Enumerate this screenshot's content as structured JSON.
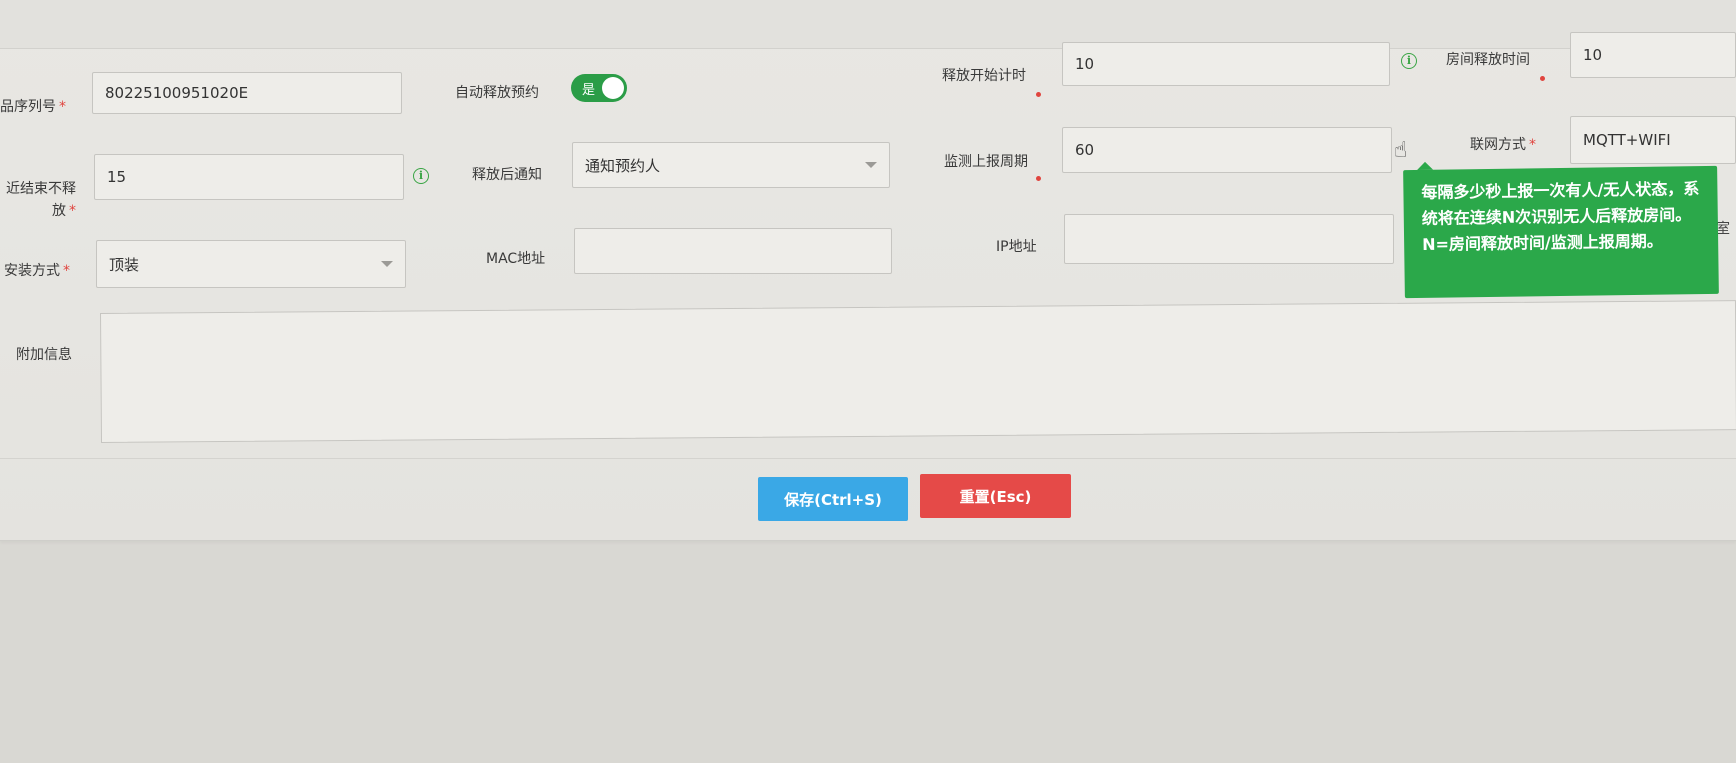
{
  "form": {
    "serial": {
      "label": "品序列号",
      "value": "80225100951020E"
    },
    "auto_release": {
      "label": "自动释放预约",
      "toggle_text": "是"
    },
    "release_start": {
      "label": "释放开始计时",
      "value": "10"
    },
    "room_release_time": {
      "label": "房间释放时间",
      "value": "10"
    },
    "near_end": {
      "label_line1": "近结束不释",
      "label_line2": "放",
      "value": "15"
    },
    "notify_after_release": {
      "label": "释放后通知",
      "value": "通知预约人"
    },
    "report_period": {
      "label": "监测上报周期",
      "value": "60"
    },
    "network_mode": {
      "label": "联网方式",
      "value": "MQTT+WIFI"
    },
    "install_mode": {
      "label": "安装方式",
      "value": "顶装"
    },
    "mac": {
      "label": "MAC地址",
      "value": ""
    },
    "ip": {
      "label": "IP地址",
      "value": ""
    },
    "extra_info": {
      "label": "附加信息",
      "value": ""
    },
    "cut_right_char": "室"
  },
  "tooltip": {
    "text": "每隔多少秒上报一次有人/无人状态，系统将在连续N次识别无人后释放房间。N=房间释放时间/监测上报周期。"
  },
  "buttons": {
    "save": "保存(Ctrl+S)",
    "reset": "重置(Esc)"
  },
  "colors": {
    "toggle_on": "#2b9d47",
    "tooltip_bg": "#2ba84a",
    "save_button": "#3aa8e6",
    "reset_button": "#e54a48",
    "required_marker": "#e0443e"
  },
  "icons": [
    "info-icon",
    "hand-pointer-icon",
    "chevron-down-icon"
  ]
}
